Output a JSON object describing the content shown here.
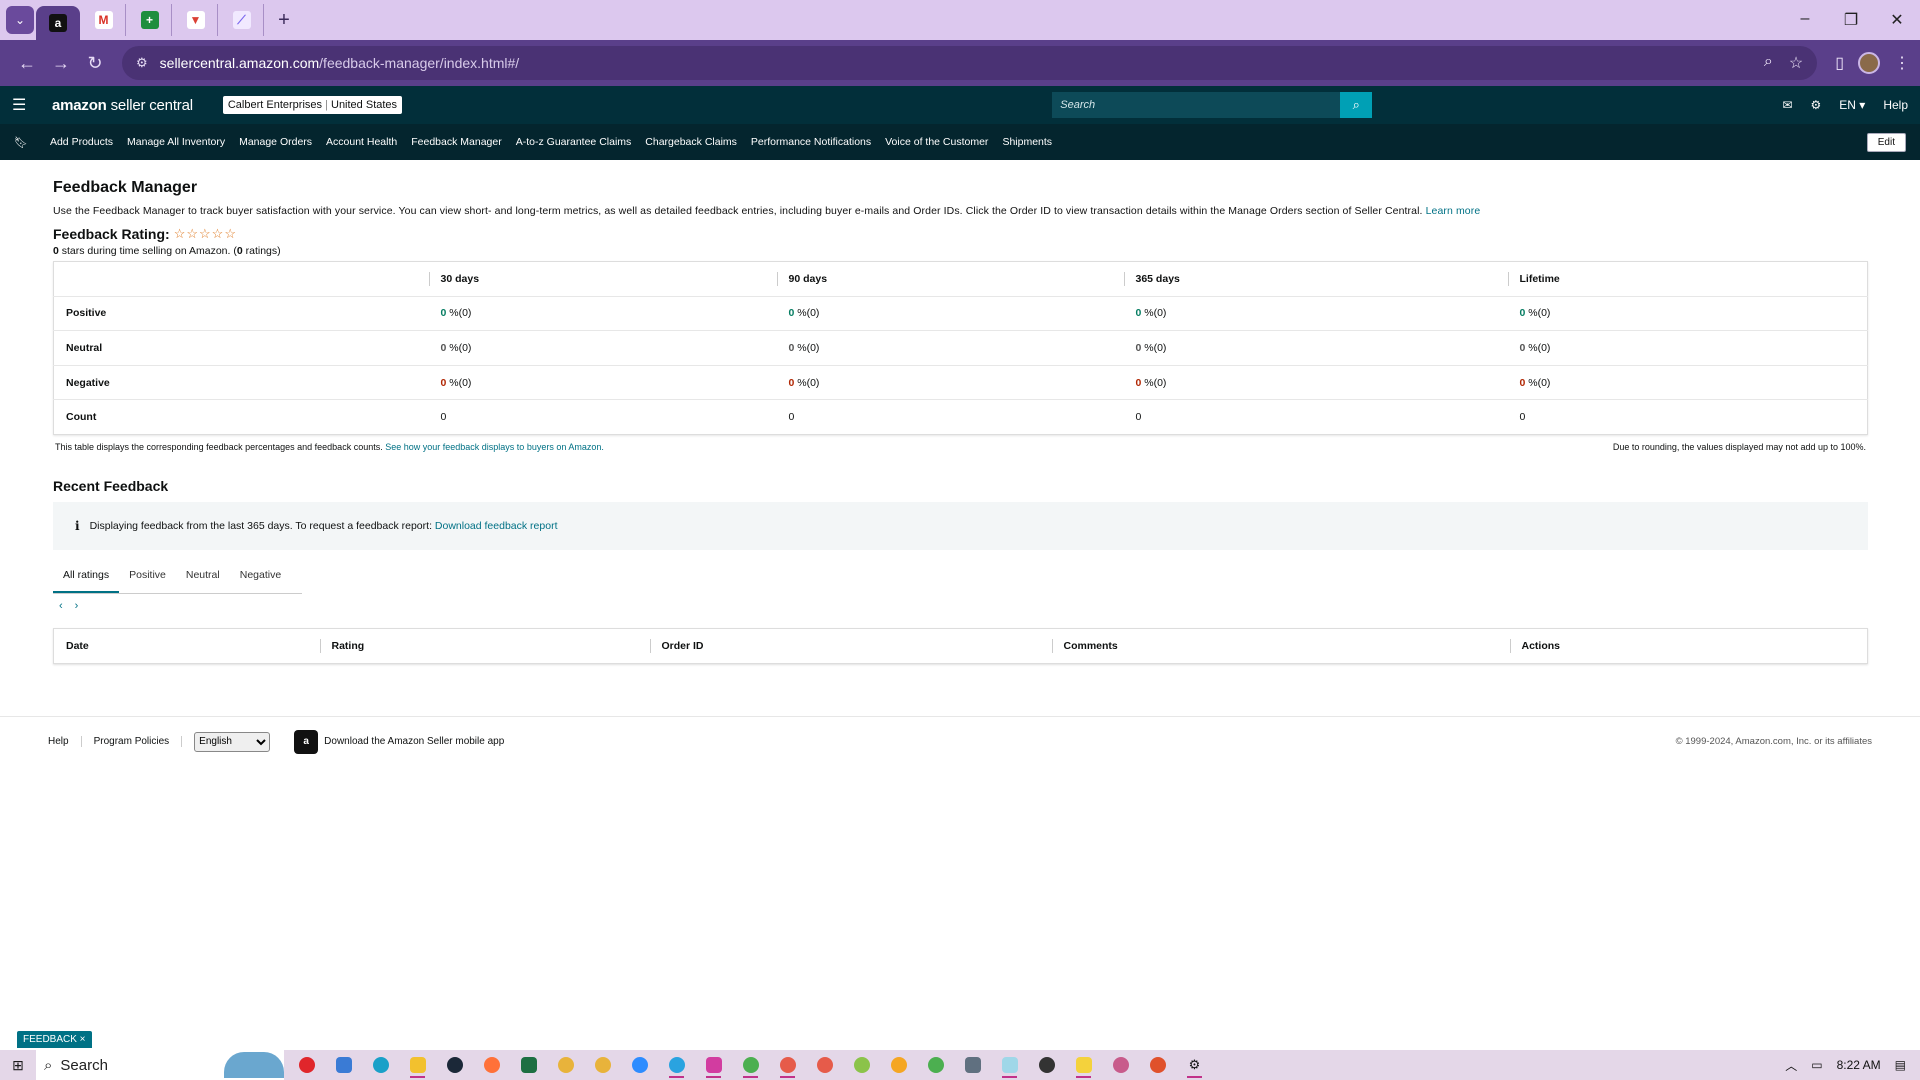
{
  "browser": {
    "url_host": "sellercentral.amazon.com",
    "url_path": "/feedback-manager/index.html#/",
    "tabs": [
      {
        "icon": "amazon-favicon",
        "letter": "a",
        "color": "#ffffff",
        "bg": "#111111"
      },
      {
        "icon": "gmail-favicon",
        "letter": "M",
        "color": "#d93025",
        "bg": "#ffffff"
      },
      {
        "icon": "sheets-favicon",
        "letter": "+",
        "color": "#ffffff",
        "bg": "#1e8e3e"
      },
      {
        "icon": "todoist-favicon",
        "letter": "▼",
        "color": "#db4035",
        "bg": "#ffffff"
      },
      {
        "icon": "clickup-favicon",
        "letter": "⟋",
        "color": "#7b68ee",
        "bg": "#f1e9ff"
      }
    ]
  },
  "header": {
    "logo_main": "amazon",
    "logo_sub": " seller central",
    "account_name": "Calbert Enterprises",
    "account_region": "United States",
    "search_placeholder": "Search",
    "lang": "EN ▾",
    "help": "Help"
  },
  "nav": {
    "items": [
      "Add Products",
      "Manage All Inventory",
      "Manage Orders",
      "Account Health",
      "Feedback Manager",
      "A-to-z Guarantee Claims",
      "Chargeback Claims",
      "Performance Notifications",
      "Voice of the Customer",
      "Shipments"
    ],
    "edit": "Edit"
  },
  "page": {
    "title": "Feedback Manager",
    "description": "Use the Feedback Manager to track buyer satisfaction with your service. You can view short- and long-term metrics, as well as detailed feedback entries, including buyer e-mails and Order IDs. Click the Order ID to view transaction details within the Manage Orders section of Seller Central.",
    "learn_more": "Learn more",
    "rating_title": "Feedback Rating:",
    "stars": "☆☆☆☆☆",
    "rating_stars": "0",
    "rating_mid": " stars during time selling on Amazon. (",
    "rating_count": "0",
    "rating_end": " ratings)"
  },
  "feedback_table": {
    "columns": [
      "30 days",
      "90 days",
      "365 days",
      "Lifetime"
    ],
    "rows": [
      {
        "label": "Positive",
        "cells": [
          {
            "n": "0",
            "s": " %(0)"
          },
          {
            "n": "0",
            "s": " %(0)"
          },
          {
            "n": "0",
            "s": " %(0)"
          },
          {
            "n": "0",
            "s": " %(0)"
          }
        ]
      },
      {
        "label": "Neutral",
        "cells": [
          {
            "n": "0",
            "s": " %(0)"
          },
          {
            "n": "0",
            "s": " %(0)"
          },
          {
            "n": "0",
            "s": " %(0)"
          },
          {
            "n": "0",
            "s": " %(0)"
          }
        ]
      },
      {
        "label": "Negative",
        "cells": [
          {
            "n": "0",
            "s": " %(0)"
          },
          {
            "n": "0",
            "s": " %(0)"
          },
          {
            "n": "0",
            "s": " %(0)"
          },
          {
            "n": "0",
            "s": " %(0)"
          }
        ]
      },
      {
        "label": "Count",
        "cells": [
          {
            "n": "",
            "s": "0"
          },
          {
            "n": "",
            "s": "0"
          },
          {
            "n": "",
            "s": "0"
          },
          {
            "n": "",
            "s": "0"
          }
        ]
      }
    ],
    "footnote": "This table displays the corresponding feedback percentages and feedback counts.",
    "footnote_link": "See how your feedback displays to buyers on Amazon.",
    "rounding_note": "Due to rounding, the values displayed may not add up to 100%."
  },
  "recent": {
    "title": "Recent Feedback",
    "info_icon": "i",
    "info_text": "Displaying feedback from the last 365 days. To request a feedback report:",
    "info_link": "Download feedback report",
    "tabs": [
      "All ratings",
      "Positive",
      "Neutral",
      "Negative"
    ],
    "prev": "‹",
    "next": "›",
    "columns": [
      "Date",
      "Rating",
      "Order ID",
      "Comments",
      "Actions"
    ]
  },
  "footer": {
    "help": "Help",
    "policies": "Program Policies",
    "language": "English",
    "app_text": "Download the Amazon Seller mobile app",
    "copyright": "© 1999-2024, Amazon.com, Inc. or its affiliates"
  },
  "feedback_tab": "FEEDBACK ×",
  "taskbar": {
    "search": "Search",
    "time": "8:22 AM"
  }
}
